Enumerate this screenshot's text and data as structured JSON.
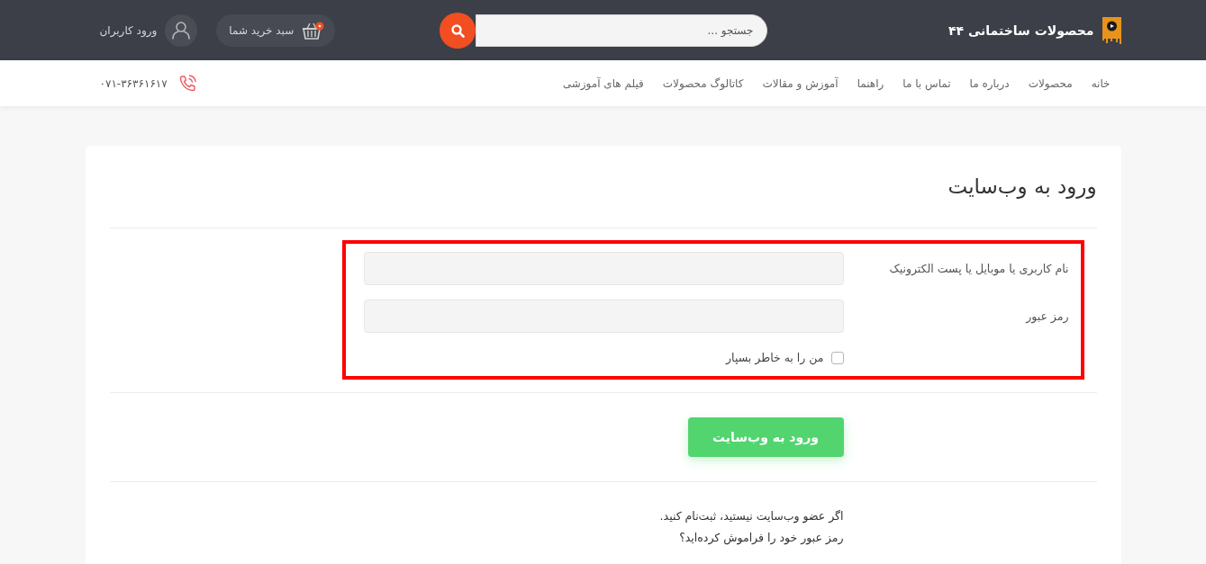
{
  "header": {
    "site_title": "محصولات ساختمانی ۴۴",
    "search": {
      "placeholder": "جستجو ..."
    },
    "cart": {
      "label": "سبد خرید شما"
    },
    "login": {
      "label": "ورود کاربران"
    }
  },
  "nav": {
    "items": [
      {
        "label": "خانه"
      },
      {
        "label": "محصولات"
      },
      {
        "label": "درباره ما"
      },
      {
        "label": "تماس با ما"
      },
      {
        "label": "راهنما"
      },
      {
        "label": "آموزش و مقالات"
      },
      {
        "label": "کاتالوگ محصولات"
      },
      {
        "label": "فیلم های آموزشی"
      }
    ],
    "phone": "۰۷۱-۳۶۳۶۱۶۱۷"
  },
  "login_form": {
    "title": "ورود به وب‌سایت",
    "fields": [
      {
        "label": "نام کاربری یا موبایل یا پست الکترونیک"
      },
      {
        "label": "رمز عبور"
      }
    ],
    "remember": {
      "label": "من را به خاطر بسپار",
      "checked": false
    },
    "submit": "ورود به وب‌سایت",
    "links": [
      "اگر عضو وب‌سایت نیستید، ثبت‌نام کنید.",
      "رمز عبور خود را فراموش کرده‌اید؟"
    ]
  }
}
